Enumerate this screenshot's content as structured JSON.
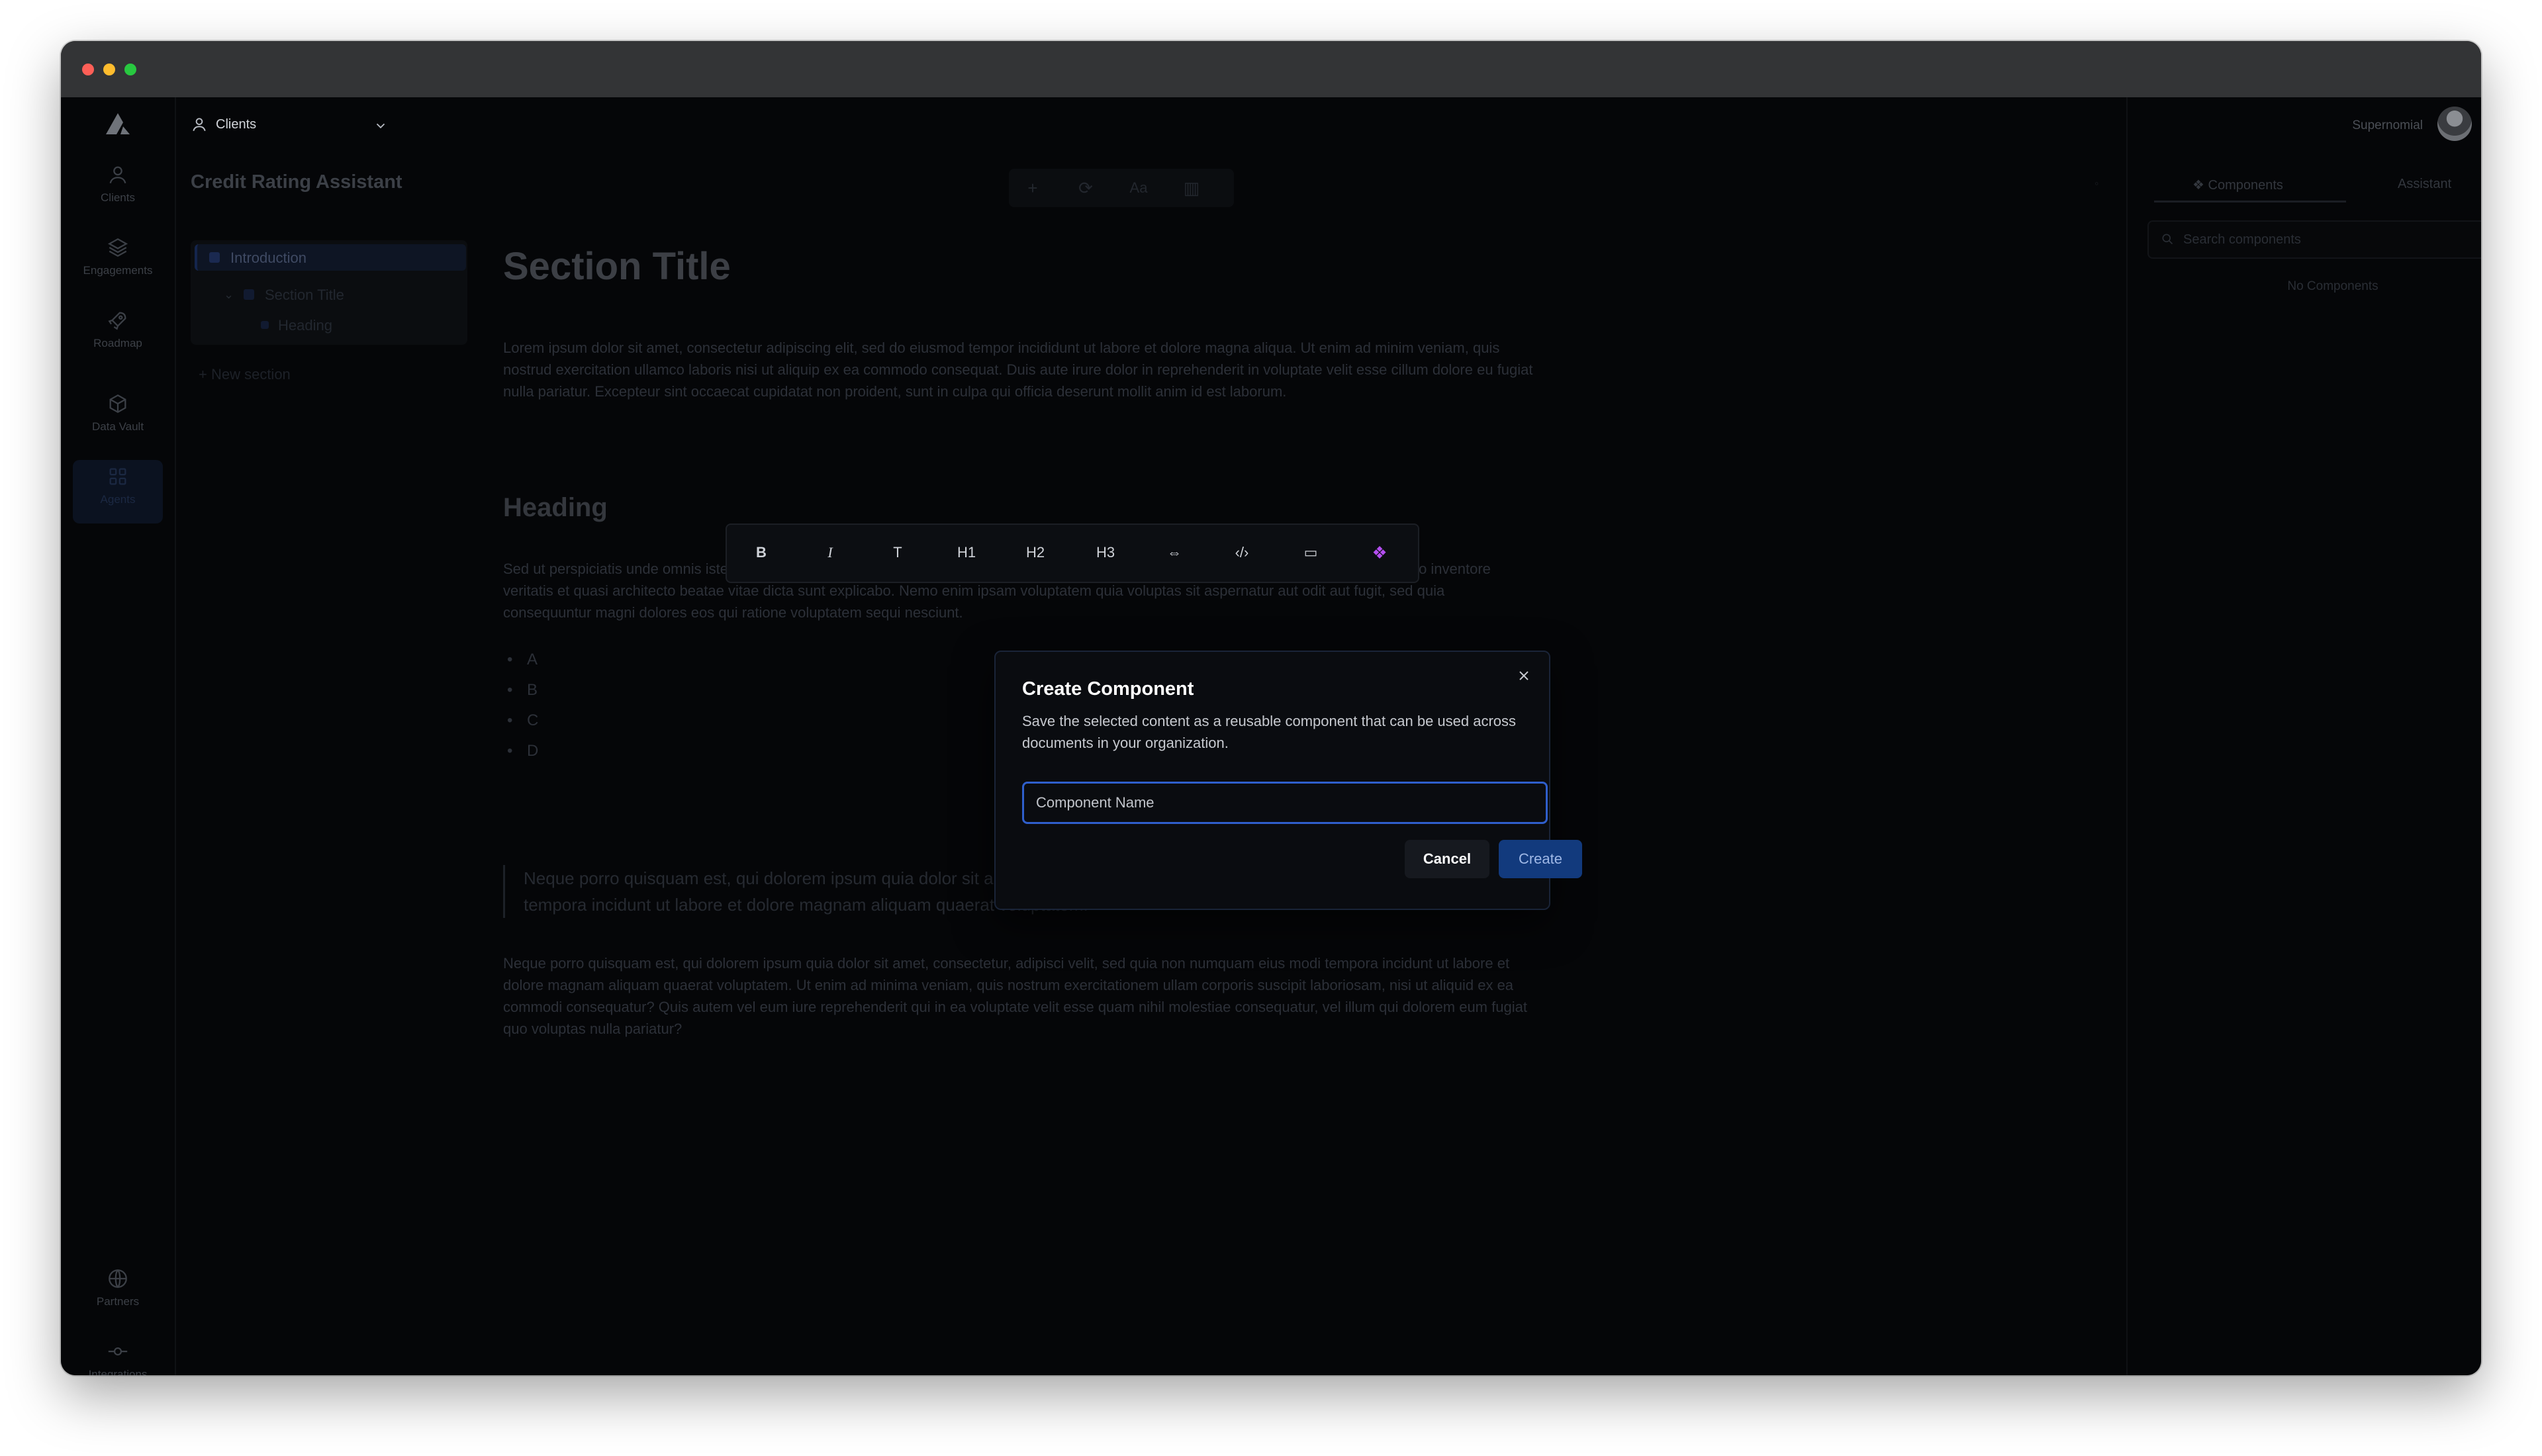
{
  "app": {
    "client_picker_label": "Clients",
    "user_name": "Supernomial",
    "title": "Credit Rating Assistant"
  },
  "rail": {
    "items": [
      {
        "label": "Clients",
        "icon": "user-icon"
      },
      {
        "label": "Engagements",
        "icon": "layers-icon"
      },
      {
        "label": "Roadmap",
        "icon": "rocket-icon"
      },
      {
        "label": "Data Vault",
        "icon": "cube-icon"
      },
      {
        "label": "Agents",
        "icon": "grid-icon"
      },
      {
        "label": "Partners",
        "icon": "globe-icon"
      },
      {
        "label": "Integrations",
        "icon": "commit-icon"
      }
    ]
  },
  "doc_nav": {
    "introduction": "Introduction",
    "section_title": "Section Title",
    "heading": "Heading",
    "new_section": "+ New section"
  },
  "doc_toolbar": [
    "+",
    "⟳",
    "Aa",
    "▥"
  ],
  "content": {
    "section_title": "Section Title",
    "para1": "Lorem ipsum dolor sit amet, consectetur adipiscing elit, sed do eiusmod tempor incididunt ut labore et dolore magna aliqua. Ut enim ad minim veniam, quis nostrud exercitation ullamco laboris nisi ut aliquip ex ea commodo consequat. Duis aute irure dolor in reprehenderit in voluptate velit esse cillum dolore eu fugiat nulla pariatur. Excepteur sint occaecat cupidatat non proident, sunt in culpa qui officia deserunt mollit anim id est laborum.",
    "heading": "Heading",
    "para2": "Sed ut perspiciatis unde omnis iste natus error sit voluptatem accusantium doloremque laudantium, totam rem aperiam, eaque ipsa quae ab illo inventore veritatis et quasi architecto beatae vitae dicta sunt explicabo. Nemo enim ipsam voluptatem quia voluptas sit aspernatur aut odit aut fugit, sed quia consequuntur magni dolores eos qui ratione voluptatem sequi nesciunt.",
    "bullets": [
      "A",
      "B",
      "C",
      "D"
    ],
    "quote": "Neque porro quisquam est, qui dolorem ipsum quia dolor sit amet, consectetur, adipisci velit, sed quia non numquam eius modi tempora incidunt ut labore et dolore magnam aliquam quaerat voluptatem.",
    "para3": "Neque porro quisquam est, qui dolorem ipsum quia dolor sit amet, consectetur, adipisci velit, sed quia non numquam eius modi tempora incidunt ut labore et dolore magnam aliquam quaerat voluptatem. Ut enim ad minima veniam, quis nostrum exercitationem ullam corporis suscipit laboriosam, nisi ut aliquid ex ea commodi consequatur? Quis autem vel eum iure reprehenderit qui in ea voluptate velit esse quam nihil molestiae consequatur, vel illum qui dolorem eum fugiat quo voluptas nulla pariatur?"
  },
  "format_toolbar": {
    "bold": "B",
    "italic": "I",
    "text": "T",
    "h1": "H1",
    "h2": "H2",
    "h3": "H3",
    "link": "⇔",
    "code": "‹/›",
    "comment": "▭",
    "component": "❖",
    "component_color": "#b44ef0"
  },
  "right_panel": {
    "tab_components": "Components",
    "tab_assistant": "Assistant",
    "search_placeholder": "Search components",
    "empty": "No Components"
  },
  "modal": {
    "title": "Create Component",
    "description": "Save the selected content as a reusable component that can be used across documents in your organization.",
    "input_placeholder": "Component Name",
    "input_value": "",
    "cancel": "Cancel",
    "create": "Create",
    "accent_color": "#2f5fcc"
  }
}
